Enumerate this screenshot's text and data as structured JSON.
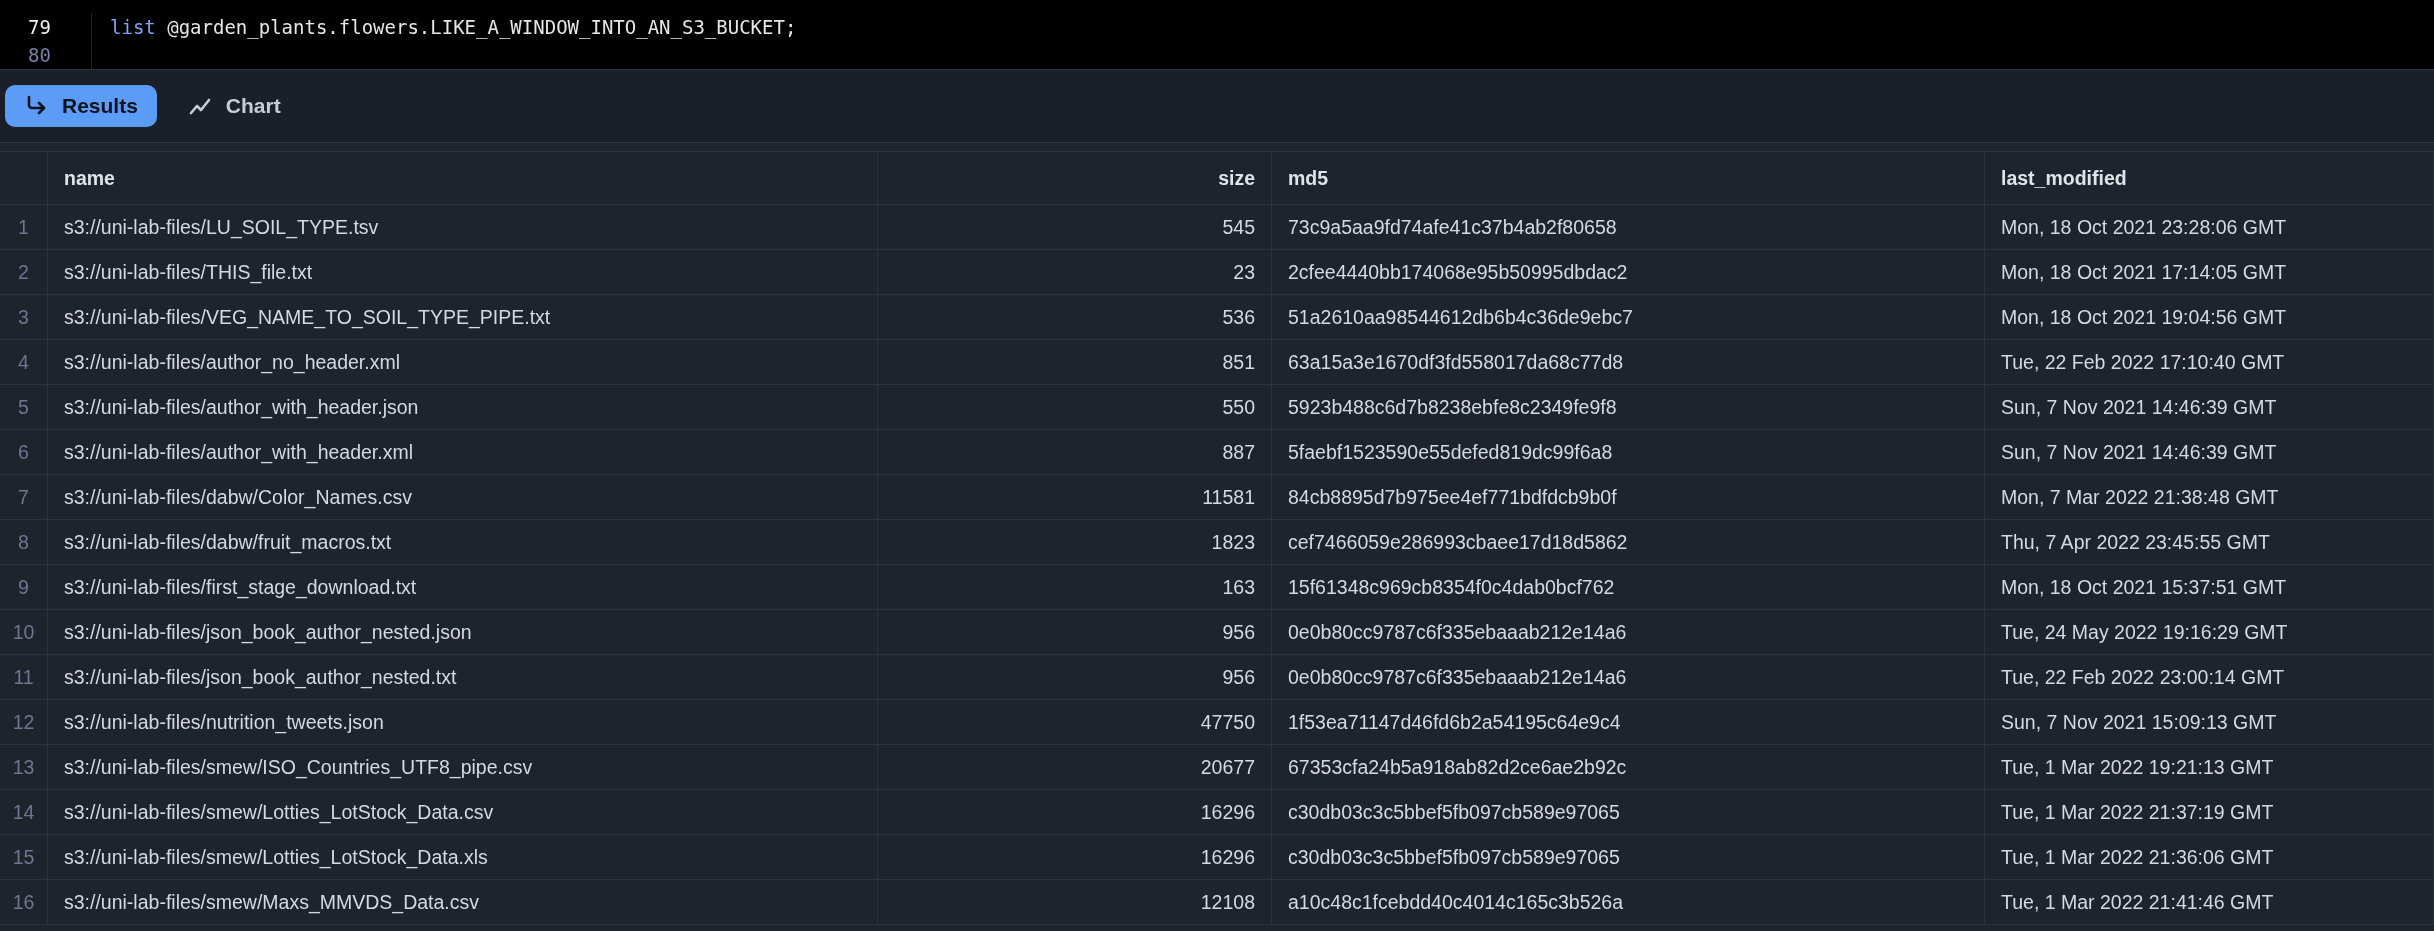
{
  "editor": {
    "lines": [
      {
        "number": "79",
        "current": true,
        "tokens": [
          {
            "kind": "keyword",
            "text": "list"
          },
          {
            "kind": "plain",
            "text": " @garden_plants.flowers.LIKE_A_WINDOW_INTO_AN_S3_BUCKET;"
          }
        ]
      },
      {
        "number": "80",
        "current": false
      }
    ]
  },
  "tabs": [
    {
      "label": "Results",
      "kind": "results",
      "selected": true
    },
    {
      "label": "Chart",
      "kind": "chart",
      "selected": false
    }
  ],
  "table": {
    "columns": [
      {
        "label": "name",
        "kind": "text"
      },
      {
        "label": "size",
        "kind": "number"
      },
      {
        "label": "md5",
        "kind": "text"
      },
      {
        "label": "last_modified",
        "kind": "text"
      }
    ],
    "rows": [
      {
        "index": "1",
        "cells": [
          "s3://uni-lab-files/LU_SOIL_TYPE.tsv",
          "545",
          "73c9a5aa9fd74afe41c37b4ab2f80658",
          "Mon, 18 Oct 2021 23:28:06 GMT"
        ]
      },
      {
        "index": "2",
        "cells": [
          "s3://uni-lab-files/THIS_file.txt",
          "23",
          "2cfee4440bb174068e95b50995dbdac2",
          "Mon, 18 Oct 2021 17:14:05 GMT"
        ]
      },
      {
        "index": "3",
        "cells": [
          "s3://uni-lab-files/VEG_NAME_TO_SOIL_TYPE_PIPE.txt",
          "536",
          "51a2610aa98544612db6b4c36de9ebc7",
          "Mon, 18 Oct 2021 19:04:56 GMT"
        ]
      },
      {
        "index": "4",
        "cells": [
          "s3://uni-lab-files/author_no_header.xml",
          "851",
          "63a15a3e1670df3fd558017da68c77d8",
          "Tue, 22 Feb 2022 17:10:40 GMT"
        ]
      },
      {
        "index": "5",
        "cells": [
          "s3://uni-lab-files/author_with_header.json",
          "550",
          "5923b488c6d7b8238ebfe8c2349fe9f8",
          "Sun, 7 Nov 2021 14:46:39 GMT"
        ]
      },
      {
        "index": "6",
        "cells": [
          "s3://uni-lab-files/author_with_header.xml",
          "887",
          "5faebf1523590e55defed819dc99f6a8",
          "Sun, 7 Nov 2021 14:46:39 GMT"
        ]
      },
      {
        "index": "7",
        "cells": [
          "s3://uni-lab-files/dabw/Color_Names.csv",
          "11581",
          "84cb8895d7b975ee4ef771bdfdcb9b0f",
          "Mon, 7 Mar 2022 21:38:48 GMT"
        ]
      },
      {
        "index": "8",
        "cells": [
          "s3://uni-lab-files/dabw/fruit_macros.txt",
          "1823",
          "cef7466059e286993cbaee17d18d5862",
          "Thu, 7 Apr 2022 23:45:55 GMT"
        ]
      },
      {
        "index": "9",
        "cells": [
          "s3://uni-lab-files/first_stage_download.txt",
          "163",
          "15f61348c969cb8354f0c4dab0bcf762",
          "Mon, 18 Oct 2021 15:37:51 GMT"
        ]
      },
      {
        "index": "10",
        "cells": [
          "s3://uni-lab-files/json_book_author_nested.json",
          "956",
          "0e0b80cc9787c6f335ebaaab212e14a6",
          "Tue, 24 May 2022 19:16:29 GMT"
        ]
      },
      {
        "index": "11",
        "cells": [
          "s3://uni-lab-files/json_book_author_nested.txt",
          "956",
          "0e0b80cc9787c6f335ebaaab212e14a6",
          "Tue, 22 Feb 2022 23:00:14 GMT"
        ]
      },
      {
        "index": "12",
        "cells": [
          "s3://uni-lab-files/nutrition_tweets.json",
          "47750",
          "1f53ea71147d46fd6b2a54195c64e9c4",
          "Sun, 7 Nov 2021 15:09:13 GMT"
        ]
      },
      {
        "index": "13",
        "cells": [
          "s3://uni-lab-files/smew/ISO_Countries_UTF8_pipe.csv",
          "20677",
          "67353cfa24b5a918ab82d2ce6ae2b92c",
          "Tue, 1 Mar 2022 19:21:13 GMT"
        ]
      },
      {
        "index": "14",
        "cells": [
          "s3://uni-lab-files/smew/Lotties_LotStock_Data.csv",
          "16296",
          "c30db03c3c5bbef5fb097cb589e97065",
          "Tue, 1 Mar 2022 21:37:19 GMT"
        ]
      },
      {
        "index": "15",
        "cells": [
          "s3://uni-lab-files/smew/Lotties_LotStock_Data.xls",
          "16296",
          "c30db03c3c5bbef5fb097cb589e97065",
          "Tue, 1 Mar 2022 21:36:06 GMT"
        ]
      },
      {
        "index": "16",
        "cells": [
          "s3://uni-lab-files/smew/Maxs_MMVDS_Data.csv",
          "12108",
          "a10c48c1fcebdd40c4014c165c3b526a",
          "Tue, 1 Mar 2022 21:41:46 GMT"
        ]
      }
    ]
  }
}
